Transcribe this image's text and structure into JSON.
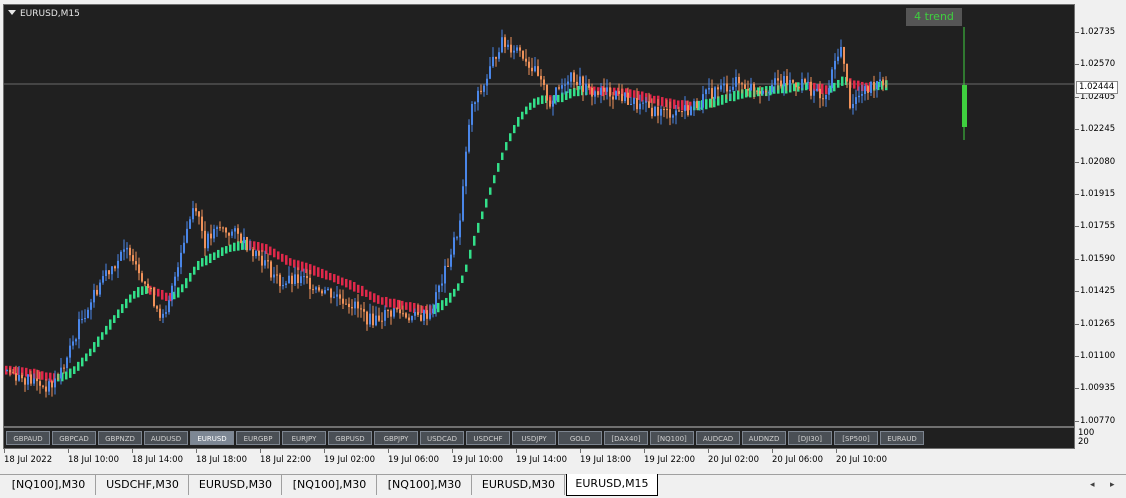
{
  "chart": {
    "title": "EURUSD,M15",
    "trend_label": "4 trend",
    "current_price": "1.02444",
    "price_scale": [
      "1.02735",
      "1.02570",
      "1.02405",
      "1.02245",
      "1.02080",
      "1.01915",
      "1.01755",
      "1.01590",
      "1.01425",
      "1.01265",
      "1.01100",
      "1.00935",
      "1.00770"
    ],
    "sub_scale": [
      "100",
      "20"
    ],
    "time_labels": [
      "18 Jul 2022",
      "18 Jul 10:00",
      "18 Jul 14:00",
      "18 Jul 18:00",
      "18 Jul 22:00",
      "19 Jul 02:00",
      "19 Jul 06:00",
      "19 Jul 10:00",
      "19 Jul 14:00",
      "19 Jul 18:00",
      "19 Jul 22:00",
      "20 Jul 02:00",
      "20 Jul 06:00",
      "20 Jul 10:00"
    ],
    "colors": {
      "background": "#202020",
      "bull_candle": "#4a86e8",
      "bear_candle": "#f0925a",
      "trend_up": "#33e08a",
      "trend_down": "#e0284a",
      "trend_box_text": "#3fcf3f"
    }
  },
  "symbols": [
    {
      "label": "GBPAUD",
      "active": false
    },
    {
      "label": "GBPCAD",
      "active": false
    },
    {
      "label": "GBPNZD",
      "active": false
    },
    {
      "label": "AUDUSD",
      "active": false
    },
    {
      "label": "EURUSD",
      "active": true
    },
    {
      "label": "EURGBP",
      "active": false
    },
    {
      "label": "EURJPY",
      "active": false
    },
    {
      "label": "GBPUSD",
      "active": false
    },
    {
      "label": "GBPJPY",
      "active": false
    },
    {
      "label": "USDCAD",
      "active": false
    },
    {
      "label": "USDCHF",
      "active": false
    },
    {
      "label": "USDJPY",
      "active": false
    },
    {
      "label": "GOLD",
      "active": false
    },
    {
      "label": "[DAX40]",
      "active": false
    },
    {
      "label": "[NQ100]",
      "active": false
    },
    {
      "label": "AUDCAD",
      "active": false
    },
    {
      "label": "AUDNZD",
      "active": false
    },
    {
      "label": "[DJI30]",
      "active": false
    },
    {
      "label": "[SP500]",
      "active": false
    },
    {
      "label": "EURAUD",
      "active": false
    }
  ],
  "tabs": [
    {
      "label": "[NQ100],M30",
      "active": false
    },
    {
      "label": "USDCHF,M30",
      "active": false
    },
    {
      "label": "EURUSD,M30",
      "active": false
    },
    {
      "label": "[NQ100],M30",
      "active": false
    },
    {
      "label": "[NQ100],M30",
      "active": false
    },
    {
      "label": "EURUSD,M30",
      "active": false
    },
    {
      "label": "EURUSD,M15",
      "active": true
    }
  ],
  "tab_scroll": {
    "left": "◂",
    "right": "▸"
  }
}
